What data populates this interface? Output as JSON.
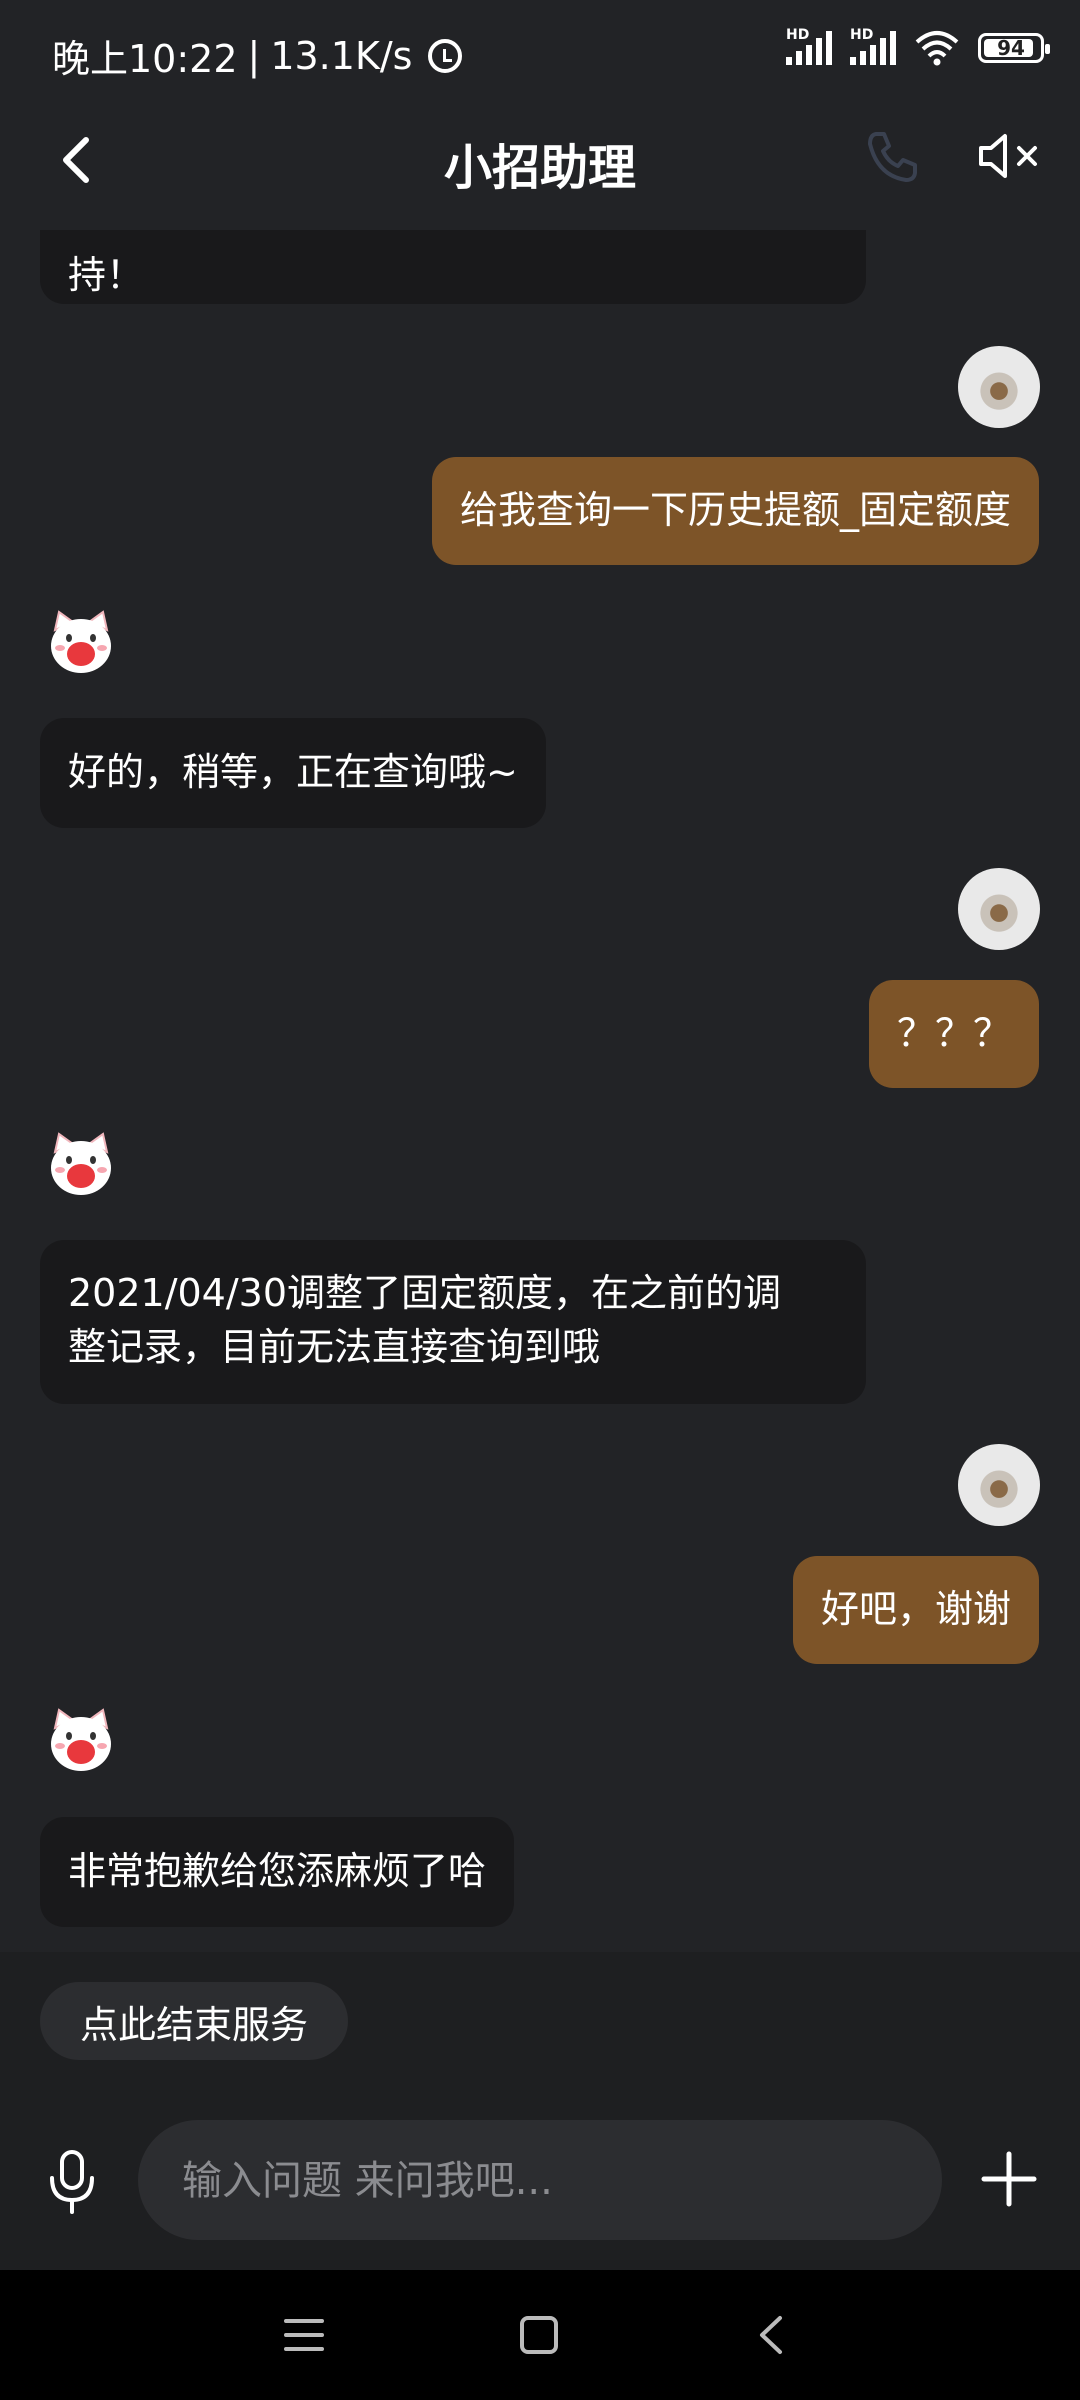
{
  "status_bar": {
    "time": "晚上10:22",
    "separator": "|",
    "net_speed": "13.1K/s",
    "signal1_label": "HD",
    "signal2_label": "HD",
    "battery": "94"
  },
  "header": {
    "title": "小招助理"
  },
  "messages": [
    {
      "sender": "bot",
      "text": "持！"
    },
    {
      "sender": "user",
      "text": "给我查询一下历史提额_固定额度"
    },
    {
      "sender": "bot",
      "text": "好的，稍等，正在查询哦~"
    },
    {
      "sender": "user",
      "text": "？？？"
    },
    {
      "sender": "bot",
      "text_line1": "2021/04/30调整了固定额度，在之前的调",
      "text_line2": "整记录，目前无法直接查询到哦"
    },
    {
      "sender": "user",
      "text": "好吧，谢谢"
    },
    {
      "sender": "bot",
      "text": "非常抱歉给您添麻烦了哈"
    }
  ],
  "quick_actions": {
    "end_service": "点此结束服务"
  },
  "input": {
    "placeholder": "输入问题 来问我吧..."
  },
  "icons": {
    "back": "chevron-left",
    "phone": "phone",
    "mute": "speaker-muted",
    "mic": "microphone",
    "plus": "plus",
    "nav_menu": "hamburger",
    "nav_home": "square",
    "nav_back": "chevron-left"
  },
  "colors": {
    "background": "#222326",
    "bot_bubble": "#19191b",
    "user_bubble": "#7d5428"
  }
}
